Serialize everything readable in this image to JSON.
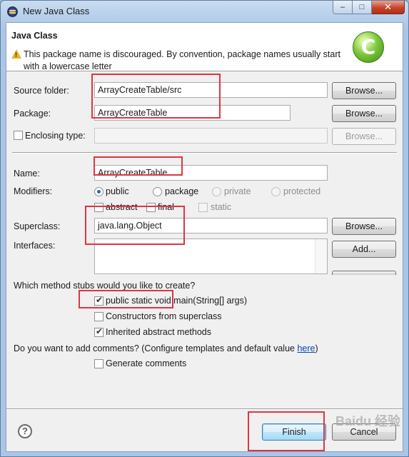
{
  "window": {
    "title": "New Java Class",
    "buttons": {
      "minimize": "–",
      "maximize": "□",
      "close": "✕"
    }
  },
  "header": {
    "title": "Java Class",
    "message": "This package name is discouraged. By convention, package names usually start with a lowercase letter",
    "icons": [
      "warning-icon",
      "new-class-logo-icon"
    ],
    "logo_glyph": "C"
  },
  "form": {
    "source_folder": {
      "label": "Source folder:",
      "value": "ArrayCreateTable/src",
      "button": "Browse..."
    },
    "package": {
      "label": "Package:",
      "value": "ArrayCreateTable",
      "button": "Browse..."
    },
    "enclosing_type": {
      "label": "Enclosing type:",
      "value": "",
      "checked": false,
      "button": "Browse..."
    },
    "name": {
      "label": "Name:",
      "value": "ArrayCreateTable"
    },
    "modifiers": {
      "label": "Modifiers:",
      "access": [
        "public",
        "package",
        "private",
        "protected"
      ],
      "selected": "public",
      "extra": [
        "abstract",
        "final",
        "static"
      ]
    },
    "superclass": {
      "label": "Superclass:",
      "value": "java.lang.Object",
      "button": "Browse..."
    },
    "interfaces": {
      "label": "Interfaces:",
      "button": "Add..."
    },
    "stubs": {
      "question": "Which method stubs would you like to create?",
      "options": [
        {
          "label": "public static void main(String[] args)",
          "checked": true
        },
        {
          "label": "Constructors from superclass",
          "checked": false
        },
        {
          "label": "Inherited abstract methods",
          "checked": true
        }
      ]
    },
    "comments": {
      "question_prefix": "Do you want to add comments? (Configure templates and default value ",
      "link": "here",
      "question_suffix": ")",
      "option": {
        "label": "Generate comments",
        "checked": false
      }
    }
  },
  "footer": {
    "help": "?",
    "finish": "Finish",
    "cancel": "Cancel"
  },
  "watermark": "Baidu 经验",
  "colors": {
    "annotation_red": "#e03540",
    "dialog_bg": "#f0f0f0",
    "link": "#0645ad"
  }
}
